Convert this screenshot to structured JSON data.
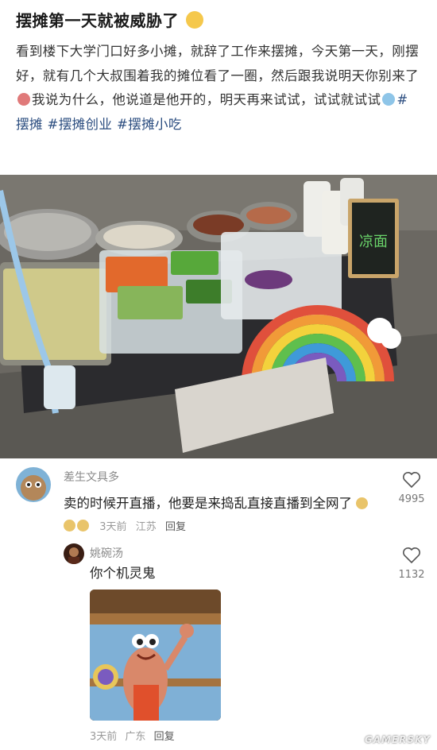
{
  "post": {
    "title": "摆摊第一天就被威胁了",
    "body": "看到楼下大学门口好多小摊，就辞了工作来摆摊，今天第一天，刚摆好，就有几个大叔围着我的摊位看了一圈，然后跟我说明天你别来了",
    "body2": "我说为什么，他说道是他开的，明天再来试试，试试就试试",
    "tags": [
      "#摆摊",
      "#摆摊创业",
      "#摆摊小吃"
    ]
  },
  "comments": [
    {
      "user": "差生文具多",
      "text": "卖的时候开直播，他要是来捣乱直接直播到全网了",
      "time": "3天前",
      "location": "江苏",
      "reply": "回复",
      "likes": "4995"
    }
  ],
  "reply": {
    "user": "姚碗汤",
    "text": "你个机灵鬼",
    "time": "3天前",
    "location": "广东",
    "reply": "回复",
    "likes": "1132"
  },
  "photo_sign": "凉面",
  "watermark": "GAMERSKY"
}
